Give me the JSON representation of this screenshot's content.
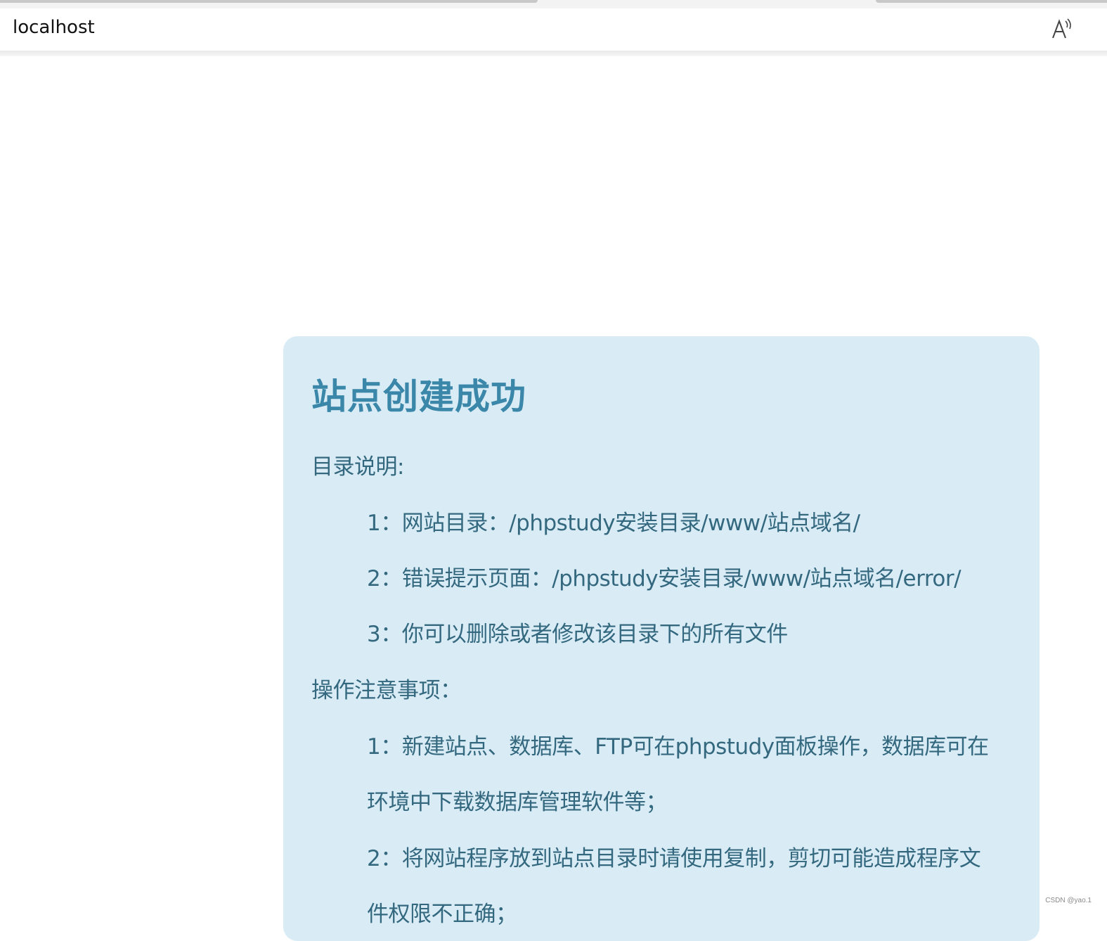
{
  "browser": {
    "url": "localhost",
    "read_aloud_icon": "read-aloud-icon"
  },
  "card": {
    "title": "站点创建成功",
    "dir_heading": "目录说明:",
    "dir_items": [
      "1：网站目录：/phpstudy安装目录/www/站点域名/",
      "2：错误提示页面：/phpstudy安装目录/www/站点域名/error/",
      "3：你可以删除或者修改该目录下的所有文件"
    ],
    "ops_heading": "操作注意事项：",
    "ops_items": [
      "1：新建站点、数据库、FTP可在phpstudy面板操作，数据库可在",
      "环境中下载数据库管理软件等；",
      "2：将网站程序放到站点目录时请使用复制，剪切可能造成程序文",
      "件权限不正确；"
    ]
  },
  "watermark": "CSDN @yao.1",
  "colors": {
    "card_bg": "#d9ecf6",
    "title": "#3a87a9",
    "body_text": "#33687f"
  }
}
